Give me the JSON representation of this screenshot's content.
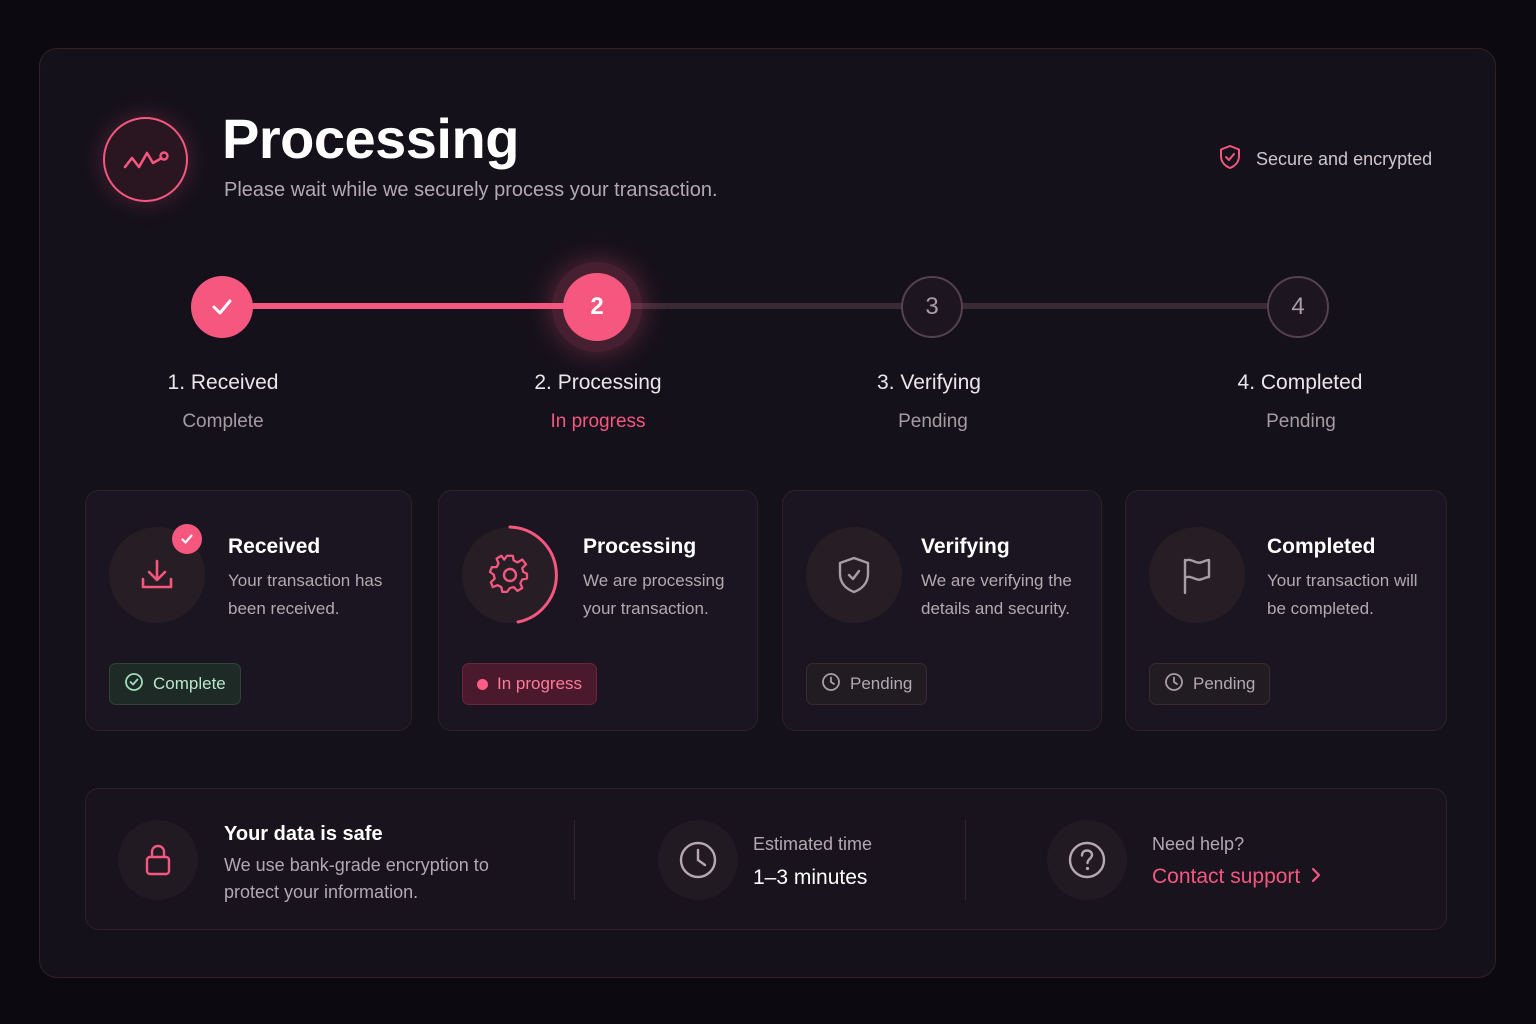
{
  "header": {
    "title": "Processing",
    "subtitle": "Please wait while we securely process your transaction.",
    "logo_icon": "activity-icon",
    "secure_text": "Secure and encrypted",
    "secure_icon": "shield-check-icon"
  },
  "colors": {
    "accent": "#f5577f",
    "background": "#0c0a10",
    "panel": "#15111a",
    "success": "#b8e6cc"
  },
  "stepper": {
    "progress": 0.33,
    "steps": [
      {
        "number": "1",
        "label": "1. Received",
        "status": "Complete",
        "state": "complete"
      },
      {
        "number": "2",
        "label": "2. Processing",
        "status": "In progress",
        "state": "active"
      },
      {
        "number": "3",
        "label": "3. Verifying",
        "status": "Pending",
        "state": "pending"
      },
      {
        "number": "4",
        "label": "4. Completed",
        "status": "Pending",
        "state": "pending"
      }
    ]
  },
  "cards": [
    {
      "title": "Received",
      "description": "Your transaction has been received.",
      "icon": "download-icon",
      "status": "Complete",
      "status_icon": "check-circle-icon"
    },
    {
      "title": "Processing",
      "description": "We are processing your transaction.",
      "icon": "gear-icon",
      "status": "In progress",
      "status_icon": "dot-icon"
    },
    {
      "title": "Verifying",
      "description": "We are verifying the details and security.",
      "icon": "shield-check-icon",
      "status": "Pending",
      "status_icon": "clock-icon"
    },
    {
      "title": "Completed",
      "description": "Your transaction will be completed.",
      "icon": "flag-icon",
      "status": "Pending",
      "status_icon": "clock-icon"
    }
  ],
  "info": {
    "safe_title": "Your data is safe",
    "safe_text": "We use bank-grade encryption to protect your information.",
    "safe_icon": "lock-icon",
    "time_label": "Estimated time",
    "time_value": "1–3 minutes",
    "time_icon": "clock-icon",
    "help_label": "Need help?",
    "help_link": "Contact support",
    "help_icon": "question-circle-icon"
  }
}
